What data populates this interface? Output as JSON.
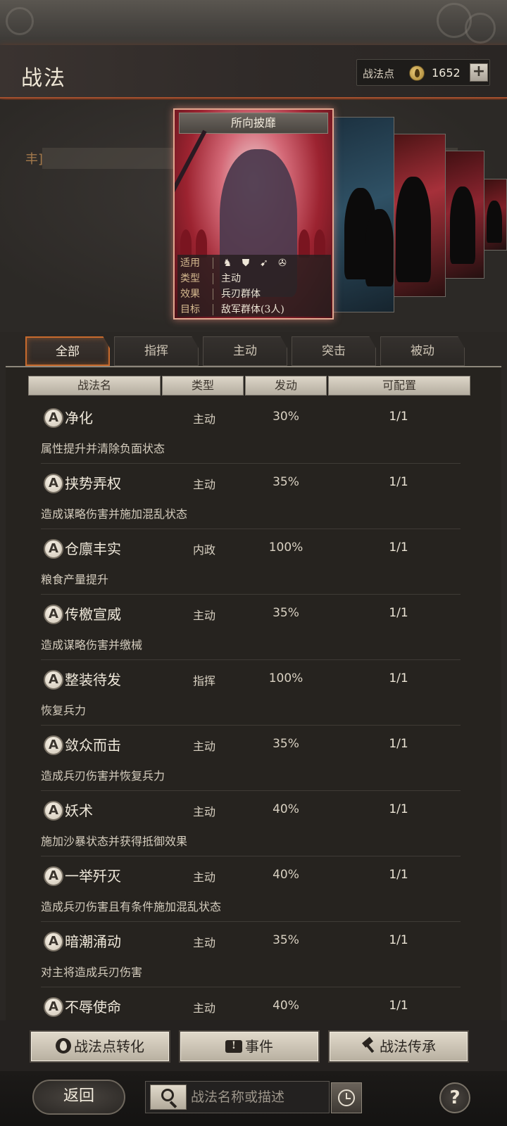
{
  "header": {
    "title": "战法",
    "points_label": "战法点",
    "points_value": "1652",
    "add_label": "+",
    "points_icon": "flame-coin-icon"
  },
  "banner": {
    "bracket_text": "丰]"
  },
  "featured_tactic": {
    "name": "所向披靡",
    "info": {
      "applies_label": "适用",
      "applies_units": [
        "cavalry-icon",
        "shield-icon",
        "bow-icon",
        "wheel-icon"
      ],
      "type_label": "类型",
      "type_value": "主动",
      "effect_label": "效果",
      "effect_value": "兵刃群体",
      "target_label": "目标",
      "target_value": "敌军群体(3人)"
    }
  },
  "tabs": [
    {
      "label": "全部",
      "active": true
    },
    {
      "label": "指挥",
      "active": false
    },
    {
      "label": "主动",
      "active": false
    },
    {
      "label": "突击",
      "active": false
    },
    {
      "label": "被动",
      "active": false
    }
  ],
  "columns": [
    "战法名",
    "类型",
    "发动",
    "可配置"
  ],
  "tactics": [
    {
      "grade": "A",
      "name": "净化",
      "type": "主动",
      "rate": "30%",
      "slots": "1/1",
      "desc": "属性提升并清除负面状态"
    },
    {
      "grade": "A",
      "name": "挟势弄权",
      "type": "主动",
      "rate": "35%",
      "slots": "1/1",
      "desc": "造成谋略伤害并施加混乱状态"
    },
    {
      "grade": "A",
      "name": "仓廪丰实",
      "type": "内政",
      "rate": "100%",
      "slots": "1/1",
      "desc": "粮食产量提升"
    },
    {
      "grade": "A",
      "name": "传檄宣威",
      "type": "主动",
      "rate": "35%",
      "slots": "1/1",
      "desc": "造成谋略伤害并缴械"
    },
    {
      "grade": "A",
      "name": "整装待发",
      "type": "指挥",
      "rate": "100%",
      "slots": "1/1",
      "desc": "恢复兵力"
    },
    {
      "grade": "A",
      "name": "敛众而击",
      "type": "主动",
      "rate": "35%",
      "slots": "1/1",
      "desc": "造成兵刃伤害并恢复兵力"
    },
    {
      "grade": "A",
      "name": "妖术",
      "type": "主动",
      "rate": "40%",
      "slots": "1/1",
      "desc": "施加沙暴状态并获得抵御效果"
    },
    {
      "grade": "A",
      "name": "一举歼灭",
      "type": "主动",
      "rate": "40%",
      "slots": "1/1",
      "desc": "造成兵刃伤害且有条件施加混乱状态"
    },
    {
      "grade": "A",
      "name": "暗潮涌动",
      "type": "主动",
      "rate": "35%",
      "slots": "1/1",
      "desc": "对主将造成兵刃伤害"
    },
    {
      "grade": "A",
      "name": "不辱使命",
      "type": "主动",
      "rate": "40%",
      "slots": "1/1",
      "desc": ""
    }
  ],
  "actions": {
    "convert_label": "战法点转化",
    "event_label": "事件",
    "inherit_label": "战法传承"
  },
  "bottom": {
    "back_label": "返回",
    "search_placeholder": "战法名称或描述",
    "help_label": "?"
  }
}
